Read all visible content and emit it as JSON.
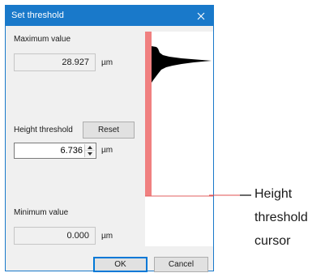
{
  "window": {
    "title": "Set threshold",
    "close_glyph": "close-icon"
  },
  "maximum": {
    "label": "Maximum value",
    "value": "28.927",
    "unit": "µm"
  },
  "threshold": {
    "label": "Height threshold",
    "reset_label": "Reset",
    "value": "6.736",
    "unit": "µm"
  },
  "minimum": {
    "label": "Minimum value",
    "value": "0.000",
    "unit": "µm"
  },
  "buttons": {
    "ok_label": "OK",
    "cancel_label": "Cancel"
  },
  "plot": {
    "threshold_fill_color": "#f08080",
    "cursor_color": "#e06060",
    "histogram_color": "#000000"
  },
  "annotation": {
    "line1": "Height",
    "line2": "threshold",
    "line3": "cursor",
    "line_color": "#e05050"
  }
}
